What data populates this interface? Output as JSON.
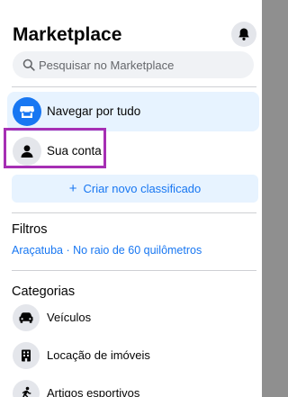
{
  "header": {
    "title": "Marketplace",
    "notifications_icon": "bell-icon"
  },
  "search": {
    "placeholder": "Pesquisar no Marketplace",
    "icon": "search-icon"
  },
  "nav": [
    {
      "label": "Navegar por tudo",
      "icon": "storefront-icon",
      "active": true
    },
    {
      "label": "Sua conta",
      "icon": "person-icon",
      "active": false
    }
  ],
  "create_button": {
    "label": "Criar novo classificado",
    "icon": "plus-icon"
  },
  "filters": {
    "title": "Filtros",
    "location": "Araçatuba · No raio de 60 quilômetros"
  },
  "categories": {
    "title": "Categorias",
    "items": [
      {
        "label": "Veículos",
        "icon": "car-icon"
      },
      {
        "label": "Locação de imóveis",
        "icon": "house-icon"
      },
      {
        "label": "Artigos esportivos",
        "icon": "sports-icon"
      }
    ]
  },
  "colors": {
    "accent": "#1877f2",
    "active_bg": "#e7f3ff",
    "highlight": "#a62fb4"
  }
}
